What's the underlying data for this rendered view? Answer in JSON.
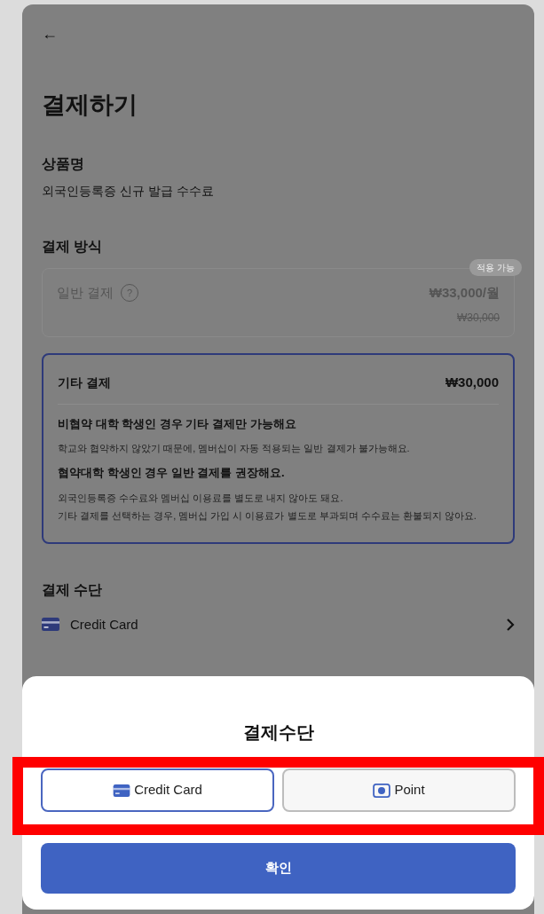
{
  "header": {
    "back": "←",
    "title": "결제하기"
  },
  "product": {
    "label": "상품명",
    "name": "외국인등록증 신규 발급 수수료"
  },
  "payment_method": {
    "label": "결제 방식",
    "options": [
      {
        "kind": "standard",
        "label": "일반 결제",
        "help": "?",
        "badge": "적용 가능",
        "price": "₩33,000/월",
        "original_price": "₩30,000",
        "selected": false,
        "disabled": true
      },
      {
        "kind": "other",
        "label": "기타 결제",
        "price": "₩30,000",
        "selected": true,
        "disabled": false,
        "notes": [
          {
            "kind": "heading",
            "text": "비협약 대학 학생인 경우 기타 결제만 가능해요"
          },
          {
            "kind": "body",
            "text": "학교와 협약하지 않았기 때문에, 멤버십이 자동 적용되는 일반 결제가 불가능해요."
          },
          {
            "kind": "heading",
            "text": "협약대학 학생인 경우 일반 결제를 권장해요."
          },
          {
            "kind": "body",
            "text": "외국인등록증 수수료와 멤버십 이용료를 별도로 내지 않아도 돼요.\n기타 결제를 선택하는 경우, 멤버십 가입 시 이용료가 별도로 부과되며 수수료는 환불되지 않아요."
          }
        ]
      }
    ]
  },
  "payment_means": {
    "label": "결제 수단",
    "method": "Credit Card"
  },
  "sheet": {
    "title": "결제수단",
    "options": [
      {
        "kind": "card",
        "label": "Credit Card",
        "selected": true
      },
      {
        "kind": "point",
        "label": "Point",
        "selected": false
      }
    ],
    "confirm": "확인"
  }
}
